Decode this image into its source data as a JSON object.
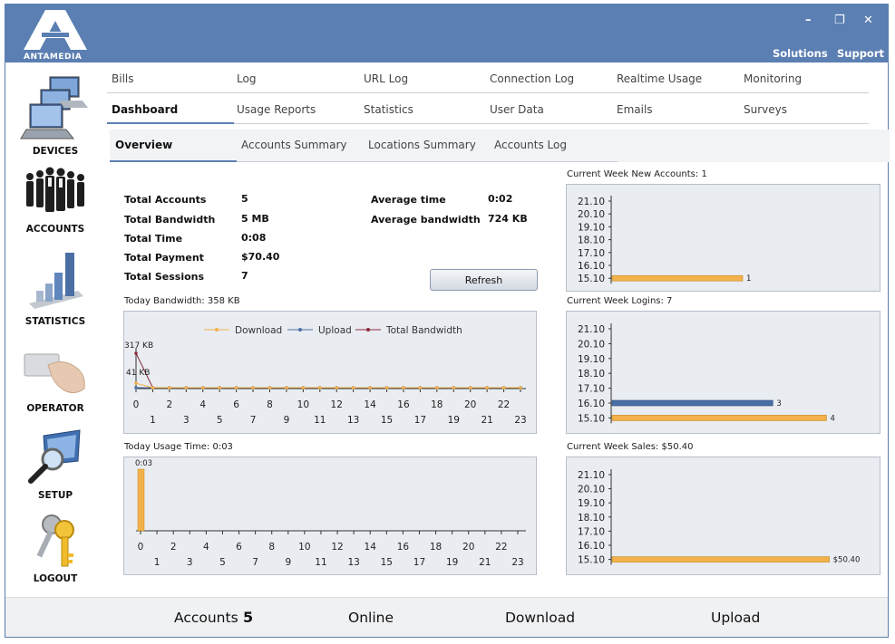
{
  "brand": {
    "name": "ANTAMEDIA"
  },
  "window_controls": {
    "minimize": "–",
    "restore": "❐",
    "close": "✕"
  },
  "top_links": {
    "solutions": "Solutions",
    "support": "Support"
  },
  "sidebar": {
    "items": [
      {
        "label": "DEVICES",
        "icon": "computers-icon"
      },
      {
        "label": "ACCOUNTS",
        "icon": "people-icon"
      },
      {
        "label": "STATISTICS",
        "icon": "bar-chart-icon"
      },
      {
        "label": "OPERATOR",
        "icon": "card-hand-icon"
      },
      {
        "label": "SETUP",
        "icon": "magnifier-monitor-icon"
      },
      {
        "label": "LOGOUT",
        "icon": "keys-icon"
      }
    ]
  },
  "nav": {
    "row1": [
      "Bills",
      "Log",
      "URL Log",
      "Connection Log",
      "Realtime Usage",
      "Monitoring"
    ],
    "row2": [
      "Dashboard",
      "Usage Reports",
      "Statistics",
      "User Data",
      "Emails",
      "Surveys"
    ],
    "active": "Dashboard"
  },
  "subtabs": {
    "items": [
      "Overview",
      "Accounts Summary",
      "Locations Summary",
      "Accounts Log"
    ],
    "active": "Overview"
  },
  "stats": {
    "left": [
      {
        "label": "Total Accounts",
        "value": "5"
      },
      {
        "label": "Total Bandwidth",
        "value": "5 MB"
      },
      {
        "label": "Total Time",
        "value": "0:08"
      },
      {
        "label": "Total Payment",
        "value": "$70.40"
      },
      {
        "label": "Total Sessions",
        "value": "7"
      }
    ],
    "right": [
      {
        "label": "Average time",
        "value": "0:02"
      },
      {
        "label": "Average bandwidth",
        "value": "724 KB"
      }
    ]
  },
  "refresh_label": "Refresh",
  "chart_data": [
    {
      "type": "line",
      "title": "Today Bandwidth: 358 KB",
      "x": [
        0,
        1,
        2,
        3,
        4,
        5,
        6,
        7,
        8,
        9,
        10,
        11,
        12,
        13,
        14,
        15,
        16,
        17,
        18,
        19,
        20,
        21,
        22,
        23
      ],
      "x_labels_even": [
        "0",
        "2",
        "4",
        "6",
        "8",
        "10",
        "12",
        "14",
        "16",
        "18",
        "20",
        "22"
      ],
      "x_labels_odd": [
        "1",
        "3",
        "5",
        "7",
        "9",
        "11",
        "13",
        "15",
        "17",
        "19",
        "21",
        "23"
      ],
      "series": [
        {
          "name": "Download",
          "values": [
            41,
            0,
            0,
            0,
            0,
            0,
            0,
            0,
            0,
            0,
            0,
            0,
            0,
            0,
            0,
            0,
            0,
            0,
            0,
            0,
            0,
            0,
            0,
            0
          ],
          "color": "#f2b14a"
        },
        {
          "name": "Upload",
          "values": [
            0,
            0,
            0,
            0,
            0,
            0,
            0,
            0,
            0,
            0,
            0,
            0,
            0,
            0,
            0,
            0,
            0,
            0,
            0,
            0,
            0,
            0,
            0,
            0
          ],
          "color": "#4a6fa5"
        },
        {
          "name": "Total Bandwidth",
          "values": [
            317,
            0,
            0,
            0,
            0,
            0,
            0,
            0,
            0,
            0,
            0,
            0,
            0,
            0,
            0,
            0,
            0,
            0,
            0,
            0,
            0,
            0,
            0,
            0
          ],
          "color": "#8b2a3a"
        }
      ],
      "point_labels": [
        "317 KB",
        "41 KB"
      ],
      "legend": "top"
    },
    {
      "type": "bar",
      "title": "Today Usage Time: 0:03",
      "x": [
        0,
        1,
        2,
        3,
        4,
        5,
        6,
        7,
        8,
        9,
        10,
        11,
        12,
        13,
        14,
        15,
        16,
        17,
        18,
        19,
        20,
        21,
        22,
        23
      ],
      "x_labels_even": [
        "0",
        "2",
        "4",
        "6",
        "8",
        "10",
        "12",
        "14",
        "16",
        "18",
        "20",
        "22"
      ],
      "x_labels_odd": [
        "1",
        "3",
        "5",
        "7",
        "9",
        "11",
        "13",
        "15",
        "17",
        "19",
        "21",
        "23"
      ],
      "values": [
        3,
        0,
        0,
        0,
        0,
        0,
        0,
        0,
        0,
        0,
        0,
        0,
        0,
        0,
        0,
        0,
        0,
        0,
        0,
        0,
        0,
        0,
        0,
        0
      ],
      "data_labels": [
        "0:03"
      ],
      "color": "#f2b14a"
    },
    {
      "type": "bar",
      "orientation": "horizontal",
      "title": "Current Week New Accounts: 1",
      "categories": [
        "21.10",
        "20.10",
        "19.10",
        "18.10",
        "17.10",
        "16.10",
        "15.10"
      ],
      "series": [
        {
          "values": [
            0,
            0,
            0,
            0,
            0,
            0,
            1
          ],
          "labels": [
            "",
            "",
            "",
            "",
            "",
            "",
            "1"
          ],
          "color": "#f2b14a"
        }
      ],
      "xlim": [
        0,
        2
      ]
    },
    {
      "type": "bar",
      "orientation": "horizontal",
      "title": "Current Week Logins: 7",
      "categories": [
        "21.10",
        "20.10",
        "19.10",
        "18.10",
        "17.10",
        "16.10",
        "15.10"
      ],
      "series": [
        {
          "values": [
            0,
            0,
            0,
            0,
            0,
            3,
            4
          ],
          "labels": [
            "",
            "",
            "",
            "",
            "",
            "3",
            "4"
          ],
          "colors": [
            "#f2b14a",
            "#f2b14a",
            "#f2b14a",
            "#f2b14a",
            "#f2b14a",
            "#4a6fa5",
            "#f2b14a"
          ]
        }
      ],
      "xlim": [
        0,
        4.5
      ]
    },
    {
      "type": "bar",
      "orientation": "horizontal",
      "title": "Current Week Sales: $50.40",
      "categories": [
        "21.10",
        "20.10",
        "19.10",
        "18.10",
        "17.10",
        "16.10",
        "15.10"
      ],
      "series": [
        {
          "values": [
            0,
            0,
            0,
            0,
            0,
            0,
            50.4
          ],
          "labels": [
            "",
            "",
            "",
            "",
            "",
            "",
            "$50.40"
          ],
          "color": "#f2b14a"
        }
      ],
      "xlim": [
        0,
        53
      ]
    }
  ],
  "footer": {
    "accounts_label": "Accounts",
    "accounts_value": "5",
    "online_label": "Online",
    "download_label": "Download",
    "upload_label": "Upload"
  }
}
